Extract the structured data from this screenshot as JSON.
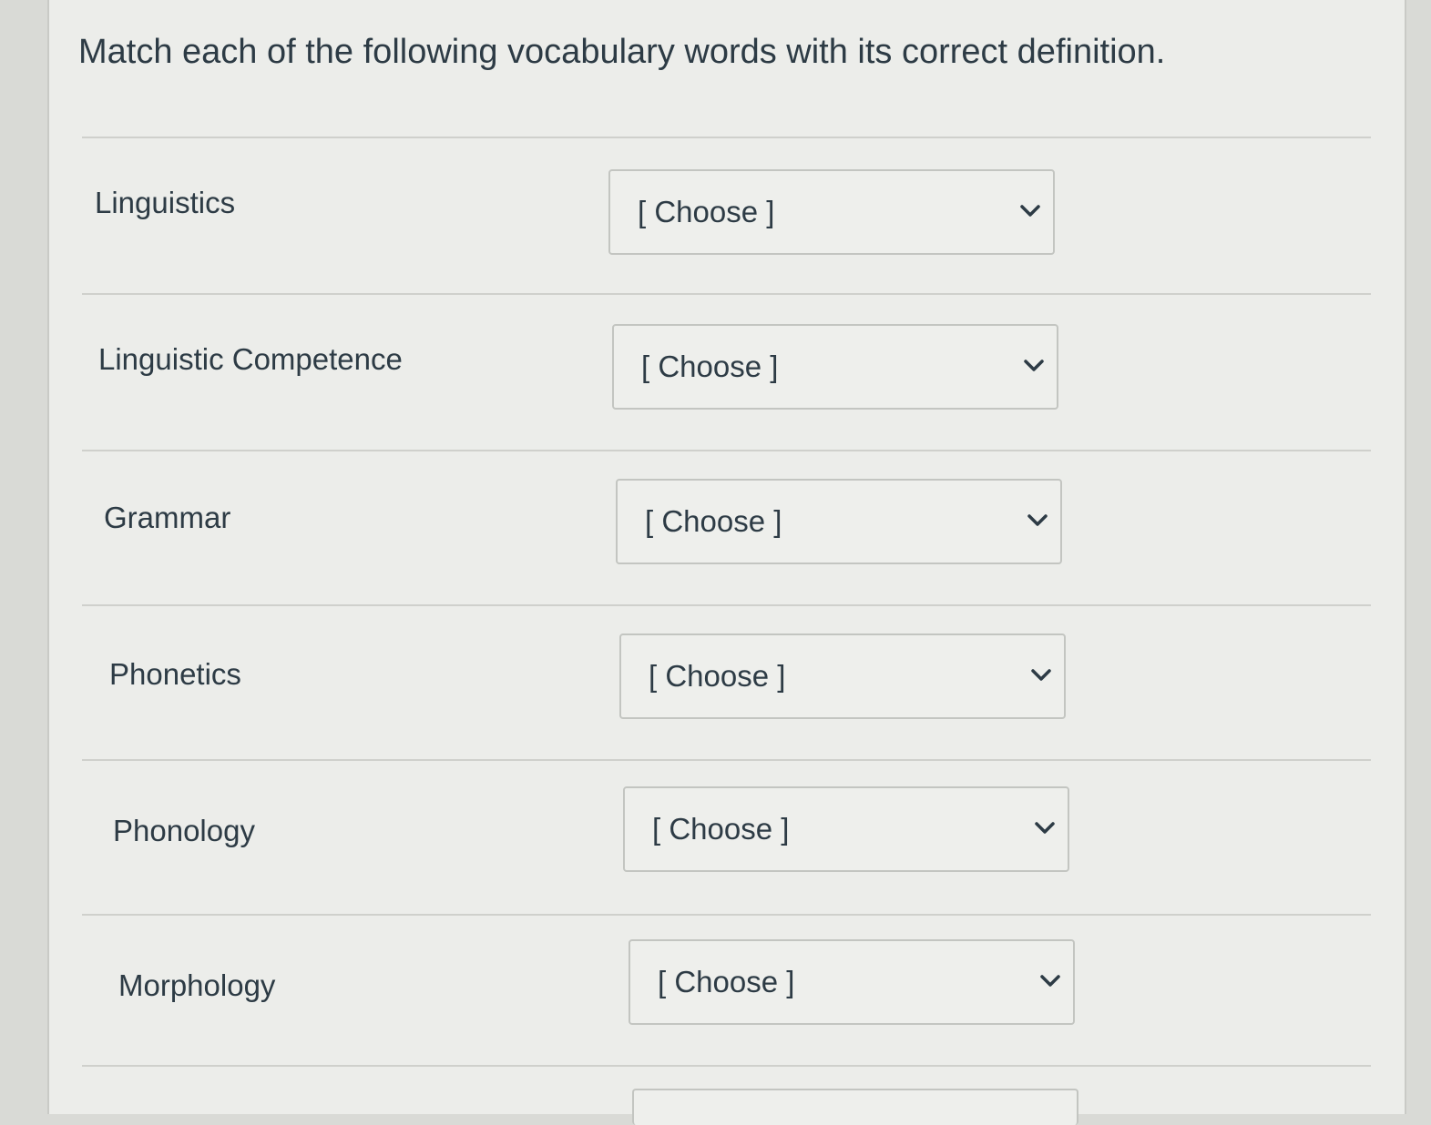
{
  "question": {
    "prompt": "Match each of the following vocabulary words with its correct definition."
  },
  "rows": [
    {
      "term": "Linguistics",
      "selected": "[ Choose ]"
    },
    {
      "term": "Linguistic Competence",
      "selected": "[ Choose ]"
    },
    {
      "term": "Grammar",
      "selected": "[ Choose ]"
    },
    {
      "term": "Phonetics",
      "selected": "[ Choose ]"
    },
    {
      "term": "Phonology",
      "selected": "[ Choose ]"
    },
    {
      "term": "Morphology",
      "selected": "[ Choose ]"
    }
  ],
  "icons": {
    "dropdown": "chevron-down-icon"
  },
  "colors": {
    "text": "#2d3b45",
    "panel": "#ecedea",
    "border": "#c3c5c1"
  }
}
